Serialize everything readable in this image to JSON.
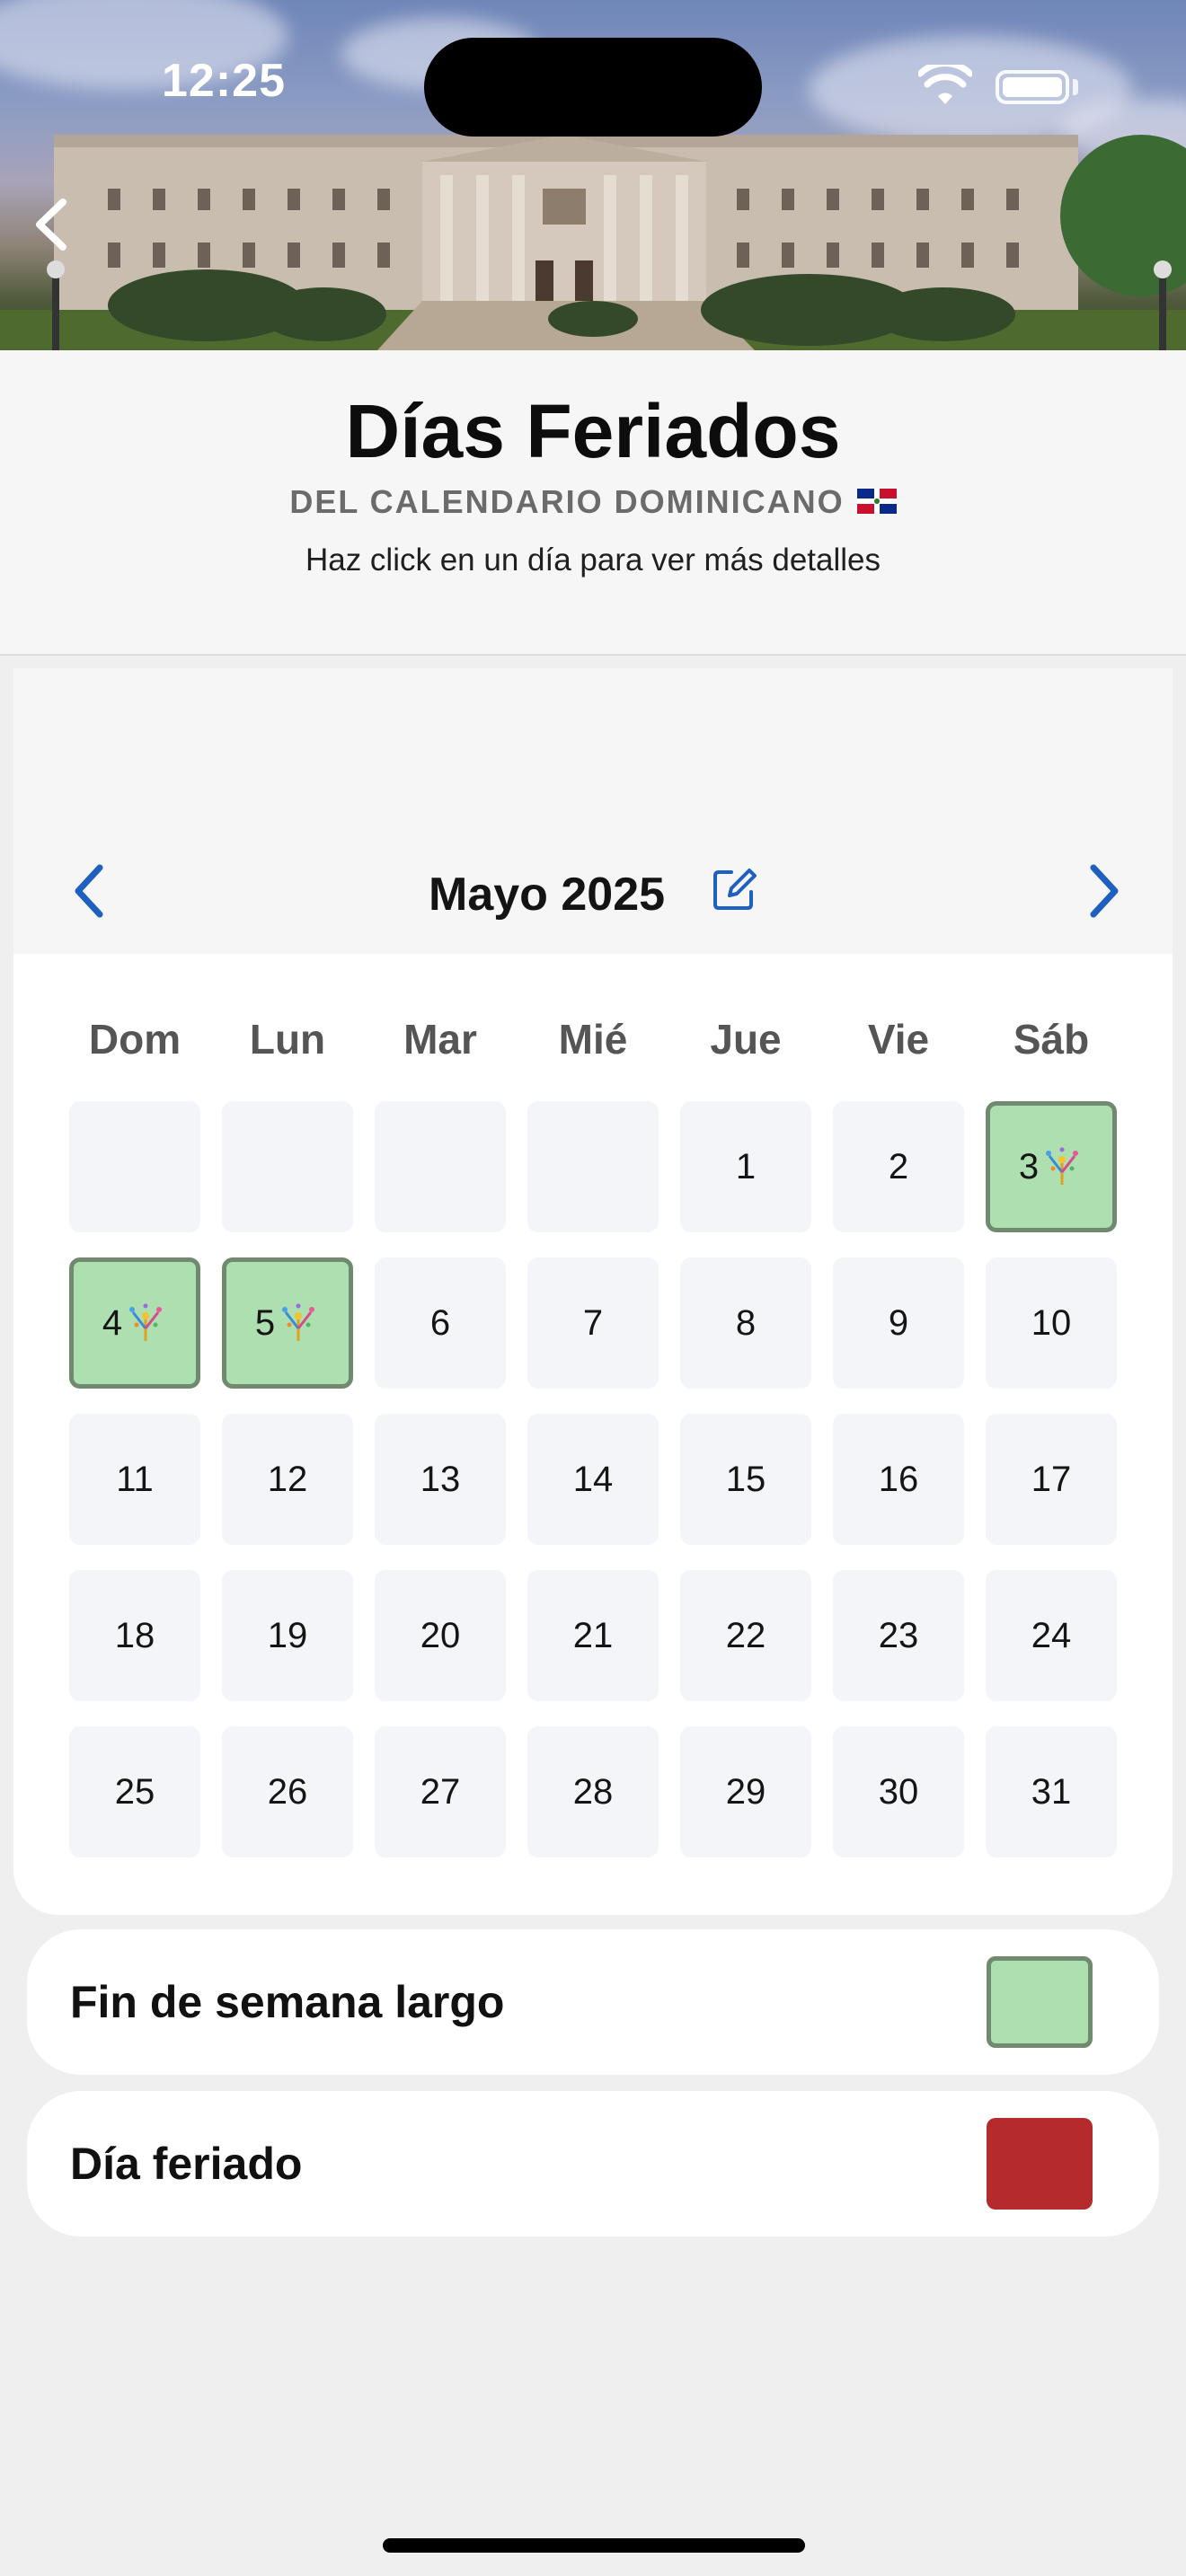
{
  "status_bar": {
    "time": "12:25"
  },
  "header": {
    "title": "Días Feriados",
    "subtitle": "DEL CALENDARIO DOMINICANO",
    "hint": "Haz click en un día para ver más detalles"
  },
  "calendar": {
    "month_label": "Mayo 2025",
    "weekdays": [
      "Dom",
      "Lun",
      "Mar",
      "Mié",
      "Jue",
      "Vie",
      "Sáb"
    ],
    "leading_empty_days": 4,
    "days_in_month": 31,
    "long_weekend_days": [
      3,
      4,
      5
    ],
    "holiday_days": []
  },
  "legend": [
    {
      "label": "Fin de semana largo",
      "color": "#aedfb1"
    },
    {
      "label": "Día feriado",
      "color": "#b52a2a"
    }
  ],
  "colors": {
    "accent": "#1f5fbf",
    "long_weekend": "#aedfb1",
    "long_weekend_border": "#6f8a6f",
    "holiday": "#b52a2a"
  }
}
